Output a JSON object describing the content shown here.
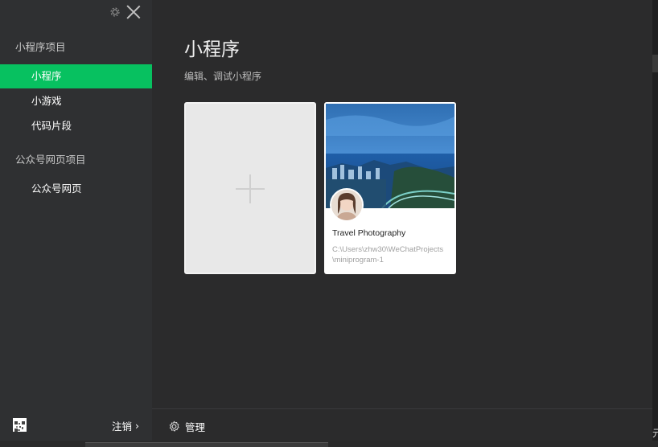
{
  "sidebar": {
    "section_miniprogram": "小程序项目",
    "items_mini": [
      {
        "label": "小程序",
        "active": true
      },
      {
        "label": "小游戏",
        "active": false
      },
      {
        "label": "代码片段",
        "active": false
      }
    ],
    "section_official": "公众号网页项目",
    "items_official": [
      {
        "label": "公众号网页",
        "active": false
      }
    ],
    "logout_label": "注销",
    "logout_chevron": "›"
  },
  "main": {
    "title": "小程序",
    "subtitle": "编辑、调试小程序",
    "project": {
      "name": "Travel Photography",
      "path": "C:\\Users\\zhw30\\WeChatProjects\\miniprogram-1"
    },
    "manage_label": "管理"
  },
  "right_edge_glyph": "元",
  "colors": {
    "accent": "#07c160",
    "sidebar_bg": "#2f3032",
    "main_bg": "#2b2b2c"
  }
}
